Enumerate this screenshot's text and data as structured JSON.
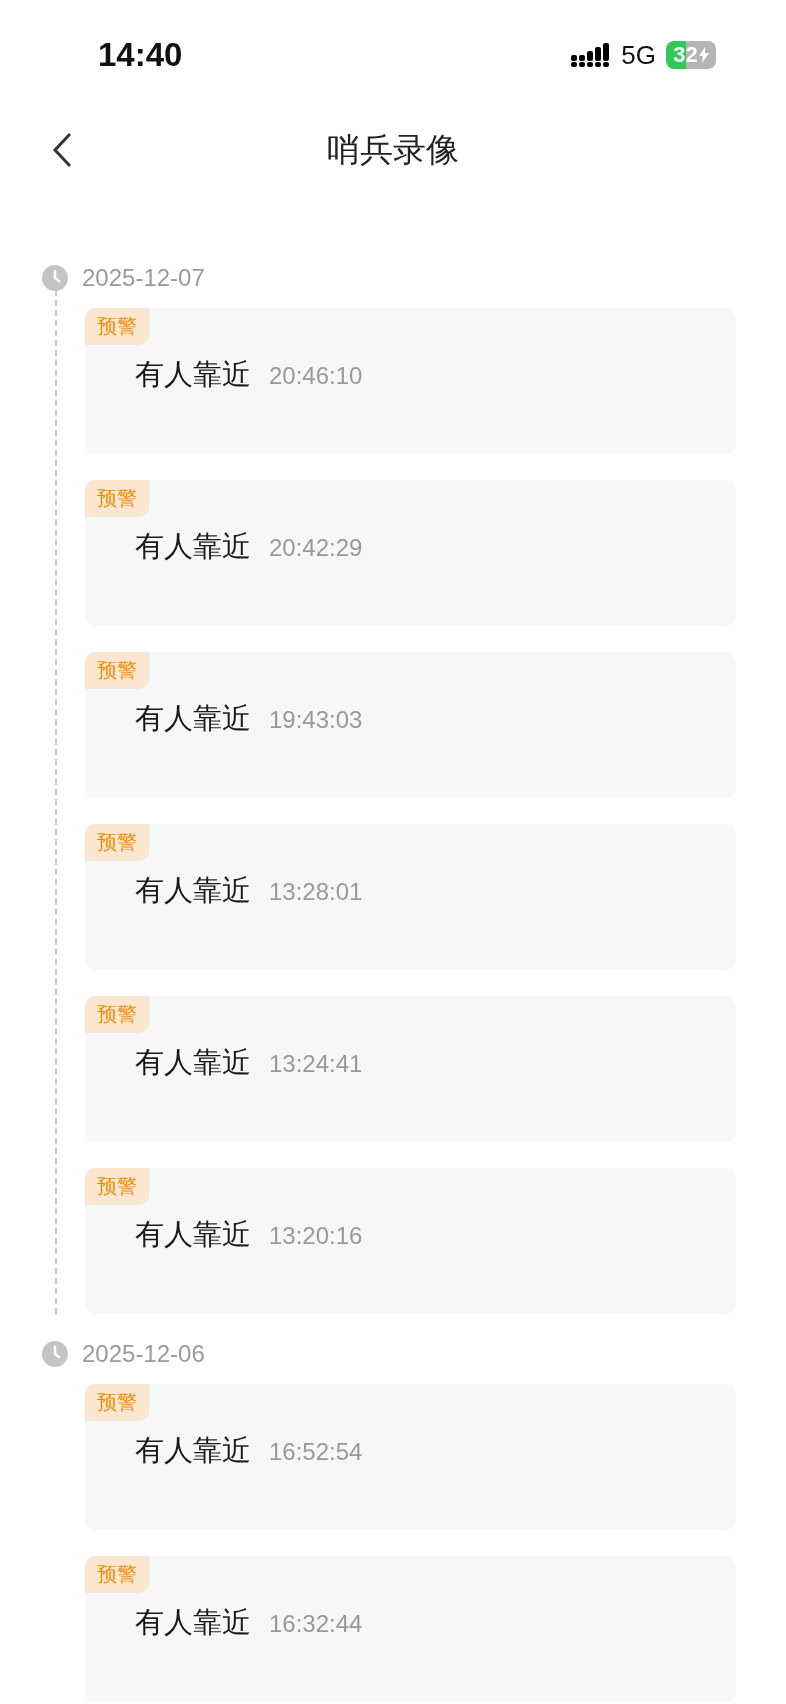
{
  "status_bar": {
    "time": "14:40",
    "network": "5G",
    "battery": "32"
  },
  "nav": {
    "title": "哨兵录像"
  },
  "groups": [
    {
      "date": "2025-12-07",
      "events": [
        {
          "tag": "预警",
          "text": "有人靠近",
          "time": "20:46:10"
        },
        {
          "tag": "预警",
          "text": "有人靠近",
          "time": "20:42:29"
        },
        {
          "tag": "预警",
          "text": "有人靠近",
          "time": "19:43:03"
        },
        {
          "tag": "预警",
          "text": "有人靠近",
          "time": "13:28:01"
        },
        {
          "tag": "预警",
          "text": "有人靠近",
          "time": "13:24:41"
        },
        {
          "tag": "预警",
          "text": "有人靠近",
          "time": "13:20:16"
        }
      ]
    },
    {
      "date": "2025-12-06",
      "events": [
        {
          "tag": "预警",
          "text": "有人靠近",
          "time": "16:52:54"
        },
        {
          "tag": "预警",
          "text": "有人靠近",
          "time": "16:32:44"
        }
      ]
    }
  ]
}
